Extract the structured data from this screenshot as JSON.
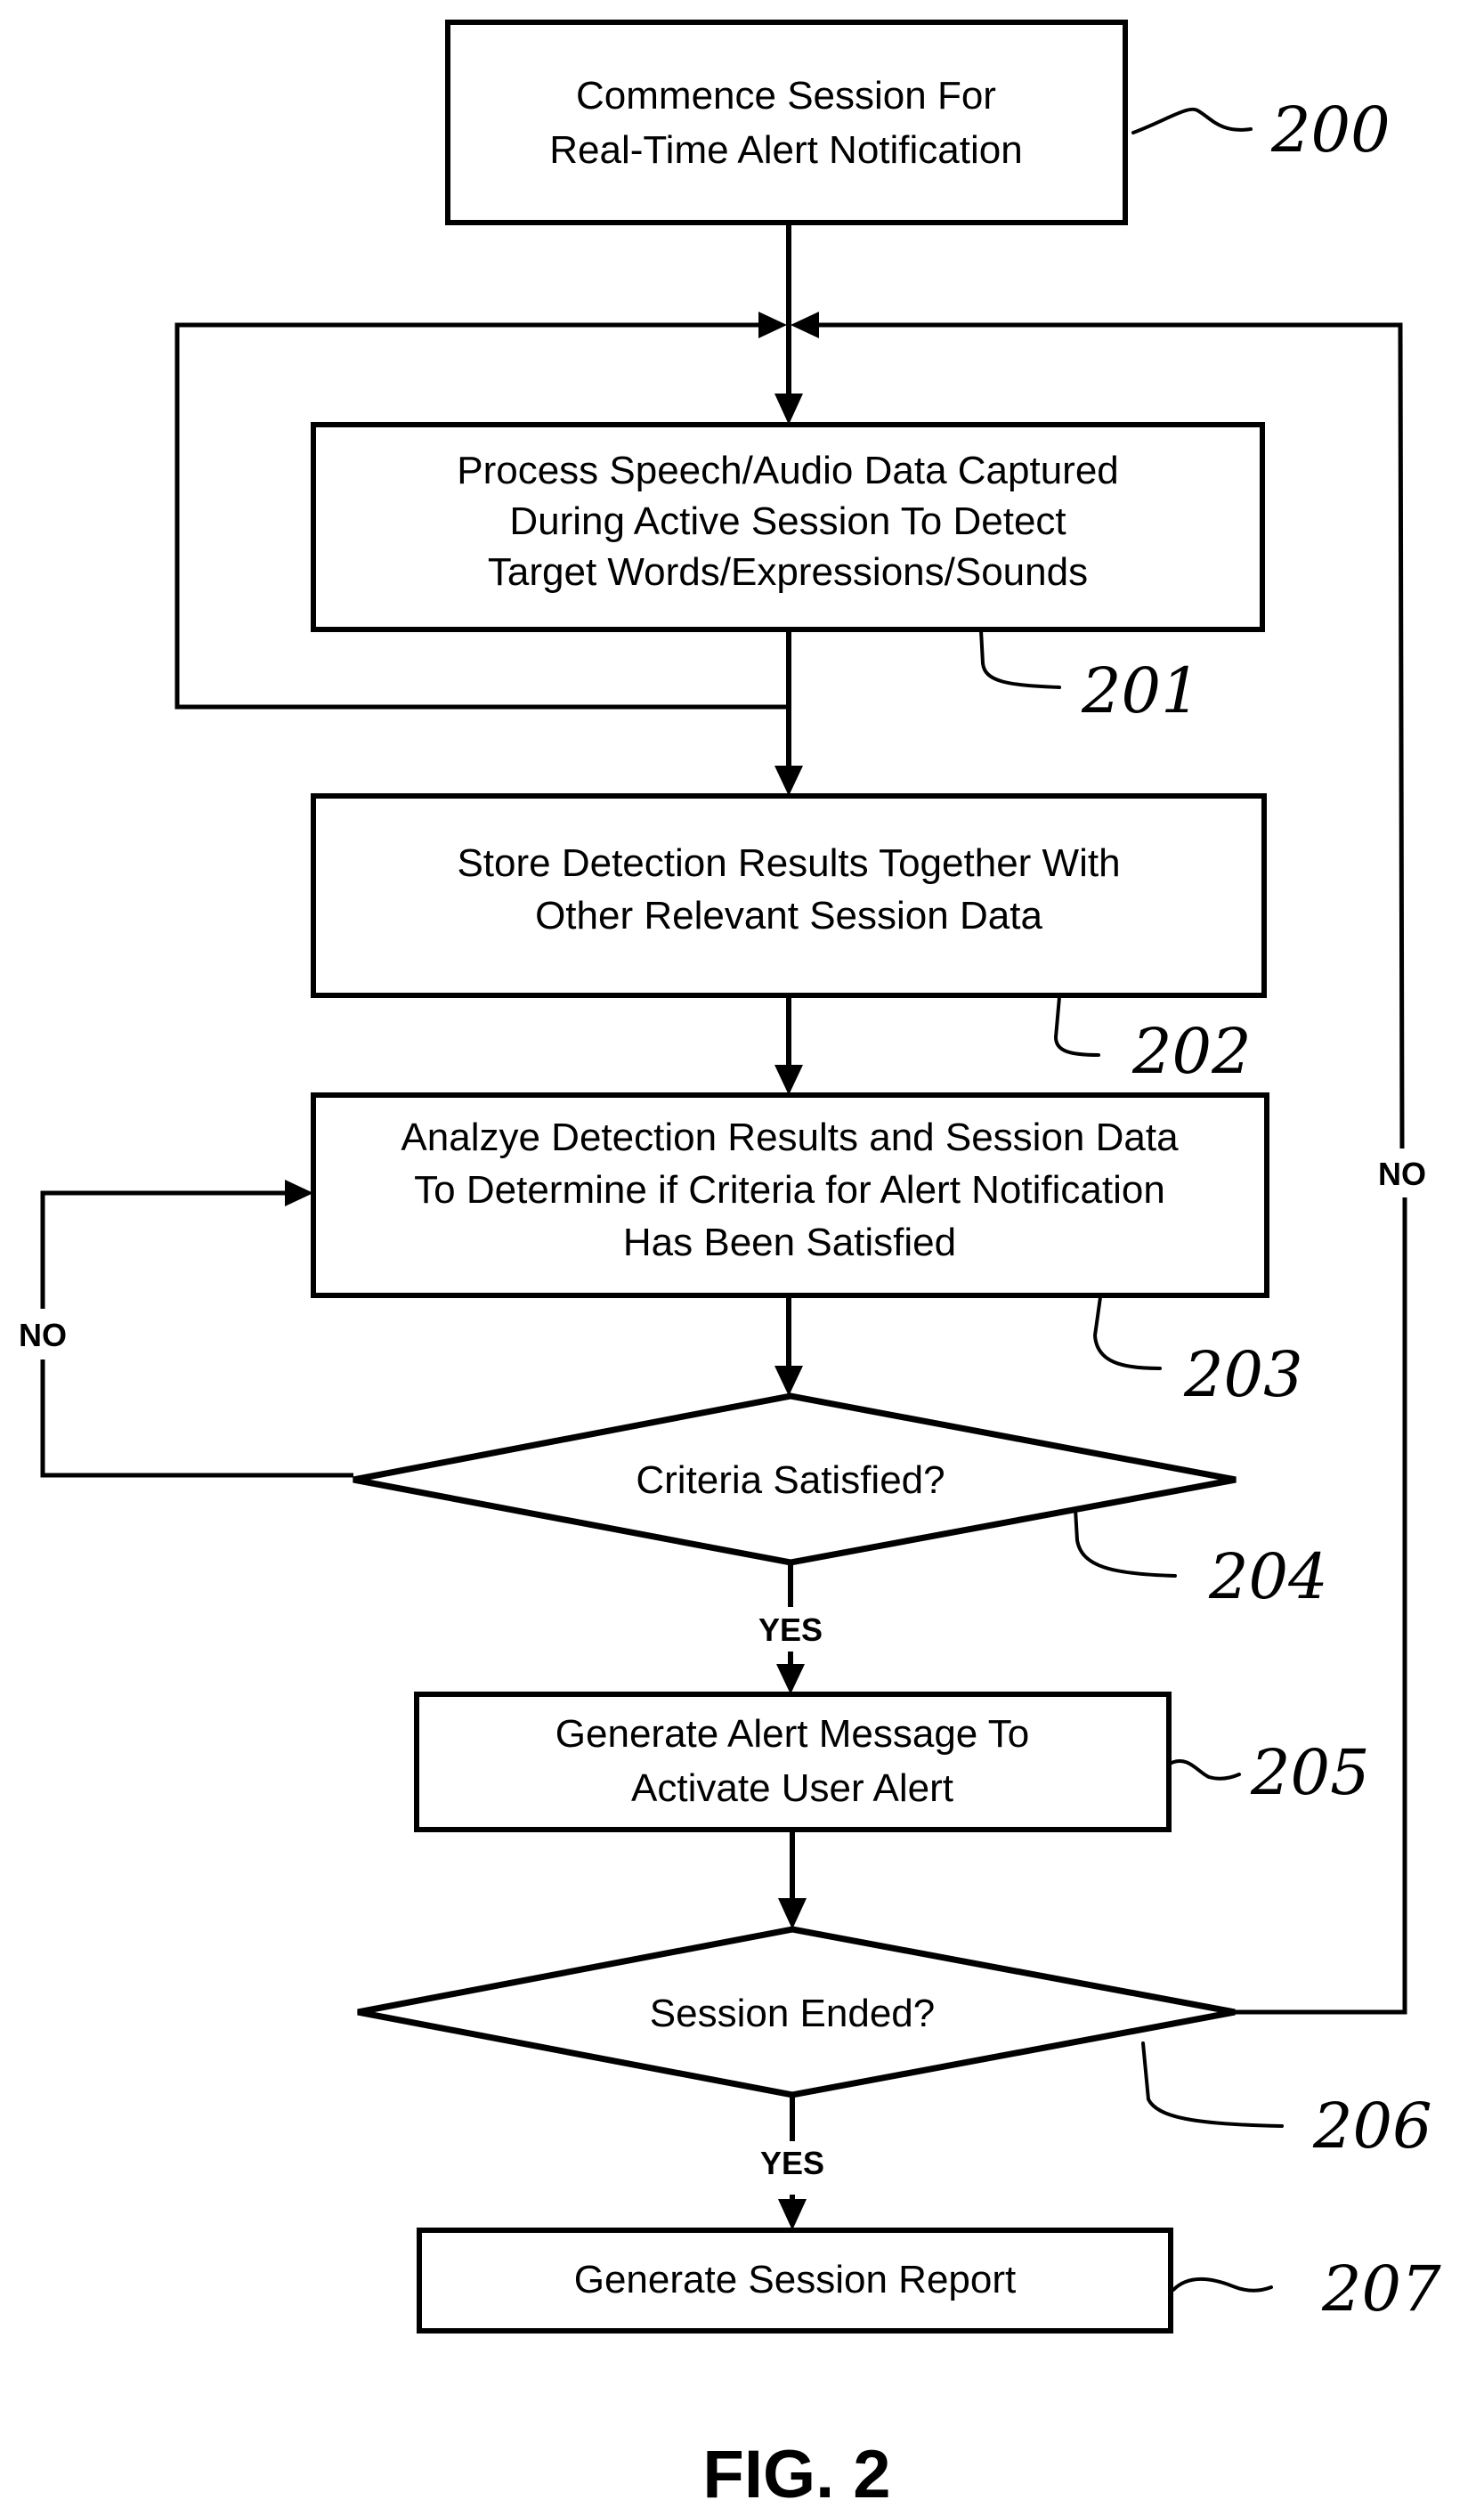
{
  "figure": {
    "caption": "FIG. 2",
    "colors": {
      "ink": "#000000",
      "paper": "#ffffff"
    }
  },
  "steps": [
    {
      "ref": "200",
      "kind": "process",
      "lines": [
        "Commence Session For",
        "Real-Time Alert Notification"
      ]
    },
    {
      "ref": "201",
      "kind": "process",
      "lines": [
        "Process Speech/Audio Data Captured",
        "During Active Session To Detect",
        "Target Words/Expressions/Sounds"
      ]
    },
    {
      "ref": "202",
      "kind": "process",
      "lines": [
        "Store Detection Results Together With",
        "Other Relevant Session Data"
      ]
    },
    {
      "ref": "203",
      "kind": "process",
      "lines": [
        "Analzye Detection Results and Session Data",
        "To Determine if Criteria for Alert Notification",
        "Has Been Satisfied"
      ]
    },
    {
      "ref": "204",
      "kind": "decision",
      "lines": [
        "Criteria Satisfied?"
      ]
    },
    {
      "ref": "205",
      "kind": "process",
      "lines": [
        "Generate Alert Message To",
        "Activate User Alert"
      ]
    },
    {
      "ref": "206",
      "kind": "decision",
      "lines": [
        "Session Ended?"
      ]
    },
    {
      "ref": "207",
      "kind": "process",
      "lines": [
        "Generate Session Report"
      ]
    }
  ],
  "branches": {
    "criteria_no": "NO",
    "criteria_yes": "YES",
    "session_no": "NO",
    "session_yes": "YES"
  },
  "connections": [
    {
      "from": "200",
      "to": "201"
    },
    {
      "from": "201",
      "to": "201",
      "note": "loop back"
    },
    {
      "from": "201",
      "to": "202"
    },
    {
      "from": "202",
      "to": "203"
    },
    {
      "from": "203",
      "to": "204"
    },
    {
      "from": "204",
      "to": "203",
      "label": "NO"
    },
    {
      "from": "204",
      "to": "205",
      "label": "YES"
    },
    {
      "from": "205",
      "to": "206"
    },
    {
      "from": "206",
      "to": "201",
      "label": "NO"
    },
    {
      "from": "206",
      "to": "207",
      "label": "YES"
    }
  ]
}
